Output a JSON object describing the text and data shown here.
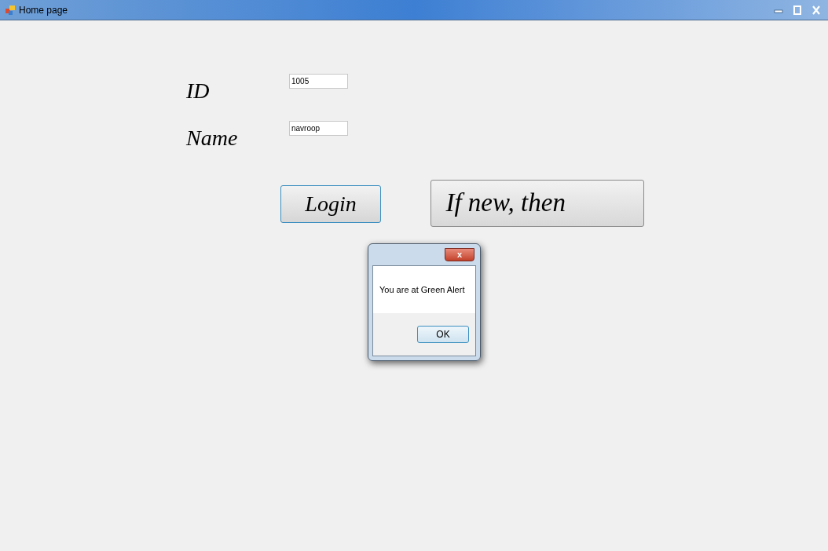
{
  "window": {
    "title": "Home page"
  },
  "form": {
    "fields": [
      {
        "label": "ID",
        "value": "1005"
      },
      {
        "label": "Name",
        "value": "navroop"
      }
    ],
    "login_button": "Login",
    "register_button": "If new, then"
  },
  "dialog": {
    "close": "x",
    "message": "You are at Green Alert",
    "ok_button": "OK"
  }
}
